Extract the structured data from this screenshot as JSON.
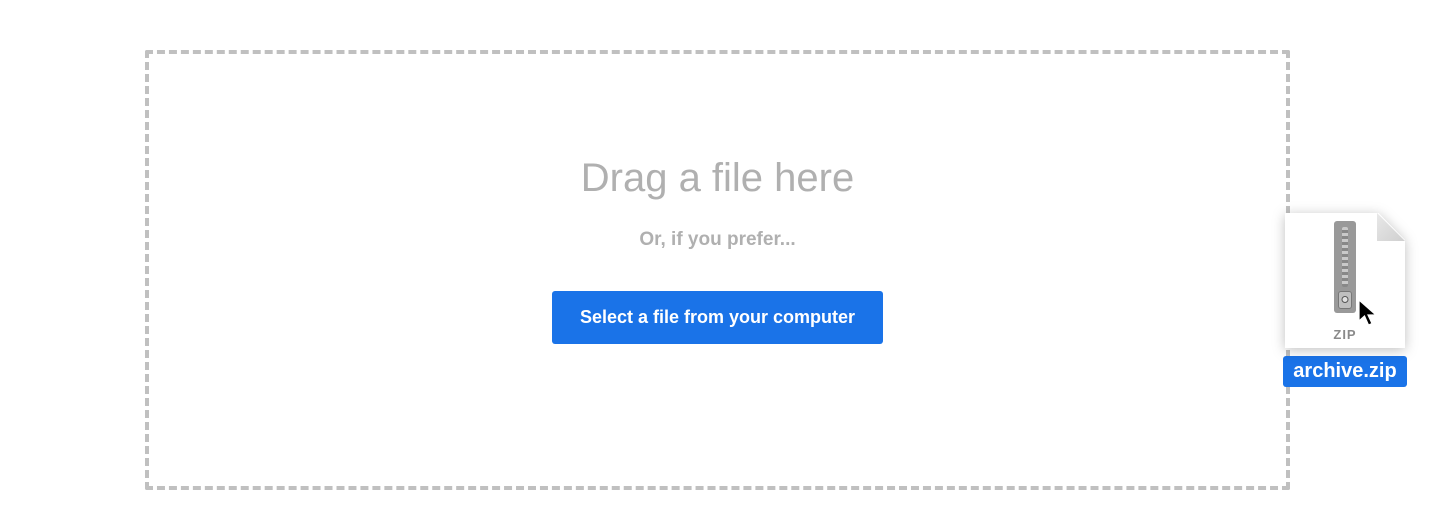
{
  "dropzone": {
    "heading": "Drag a file here",
    "subtext": "Or, if you prefer...",
    "button_label": "Select a file from your computer"
  },
  "dragged_file": {
    "filename": "archive.zip",
    "ext_label": "ZIP",
    "icon": "zip-file-icon"
  },
  "colors": {
    "accent": "#1a73e8",
    "border": "#c0c0c0",
    "muted_text": "#b0b0b0"
  }
}
